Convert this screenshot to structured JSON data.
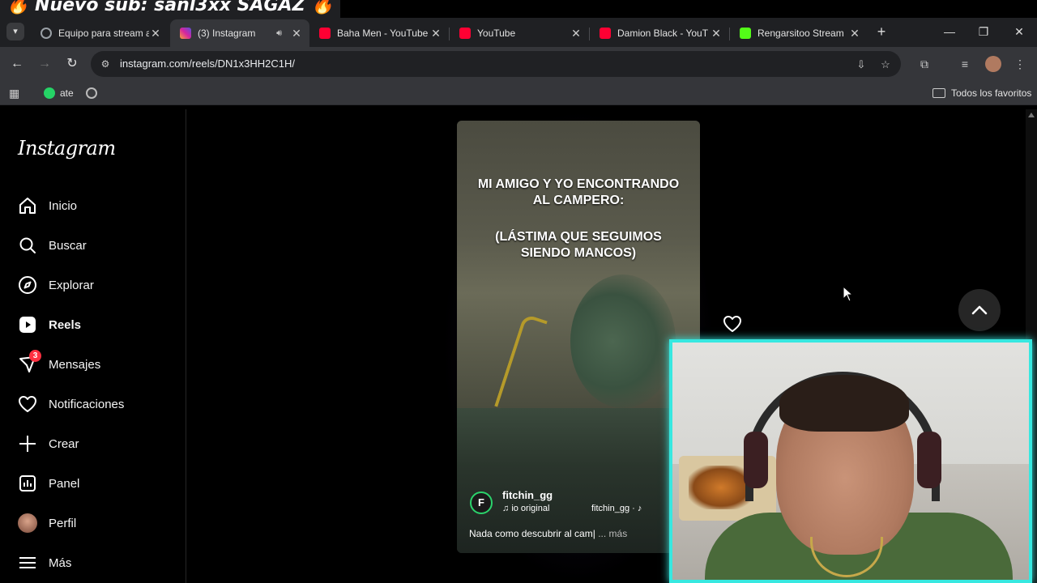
{
  "stream_title": "🔥 Nuevo sub: sanl3xx SAGAZ 🔥",
  "tabs": [
    {
      "label": "Equipo para stream a",
      "favicon_color": "#8ab4f8"
    },
    {
      "label": "(3) Instagram",
      "favicon_color": "#d6249f",
      "active": true
    },
    {
      "label": "Baha Men - YouTube",
      "favicon_color": "#ff0033"
    },
    {
      "label": "YouTube",
      "favicon_color": "#ff0033"
    },
    {
      "label": "Damion Black - YouT",
      "favicon_color": "#ff0033"
    },
    {
      "label": "Rengarsitoo Stream",
      "favicon_color": "#53fc18"
    }
  ],
  "address": {
    "url": "instagram.com/reels/DN1x3HH2C1H/"
  },
  "bookmarks": {
    "item1": "ate",
    "all_favorites": "Todos los favoritos"
  },
  "instagram": {
    "logo": "Instagram",
    "nav": [
      {
        "label": "Inicio",
        "icon": "home-icon"
      },
      {
        "label": "Buscar",
        "icon": "search-icon"
      },
      {
        "label": "Explorar",
        "icon": "compass-icon"
      },
      {
        "label": "Reels",
        "icon": "reels-icon"
      },
      {
        "label": "Mensajes",
        "icon": "messenger-icon",
        "badge": "3"
      },
      {
        "label": "Notificaciones",
        "icon": "heart-icon"
      },
      {
        "label": "Crear",
        "icon": "plus-icon"
      },
      {
        "label": "Panel",
        "icon": "dashboard-icon"
      },
      {
        "label": "Perfil",
        "icon": "avatar"
      },
      {
        "label": "Más",
        "icon": "menu-icon"
      }
    ],
    "reel": {
      "caption_line1": "MI AMIGO Y YO ENCONTRANDO",
      "caption_line2": "AL CAMPERO:",
      "caption_line3": "(LÁSTIMA QUE SEGUIMOS",
      "caption_line4": "SIENDO MANCOS)",
      "account": "fitchin_gg",
      "audio": "io original",
      "audio_user": "fitchin_gg · ♪",
      "description": "Nada como descubrir al cam|",
      "more": "... más"
    }
  },
  "colors": {
    "accent": "#37e8e0",
    "badge": "#ff3040"
  }
}
